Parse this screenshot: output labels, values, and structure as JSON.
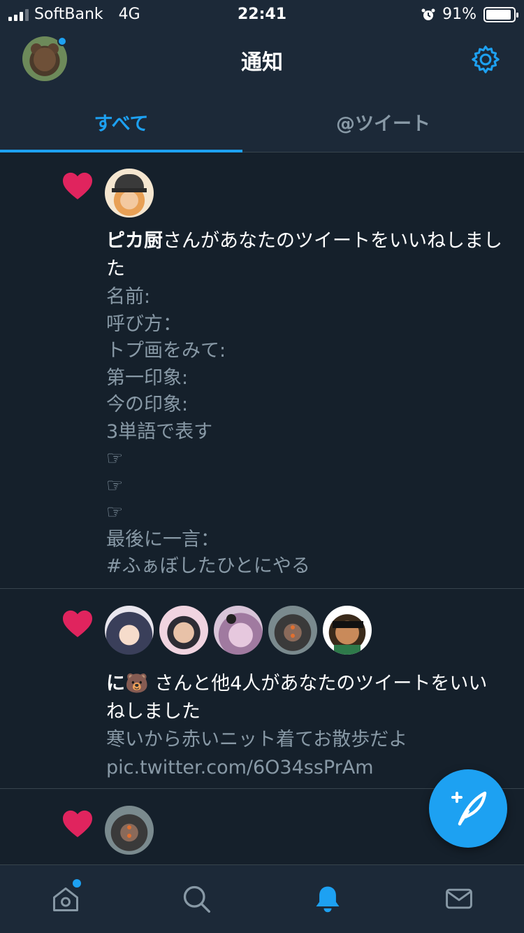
{
  "status_bar": {
    "carrier": "SoftBank",
    "network": "4G",
    "time": "22:41",
    "battery_percent": "91%",
    "battery_level": 0.91
  },
  "header": {
    "title": "通知"
  },
  "tabs": [
    {
      "label": "すべて",
      "selected": true
    },
    {
      "label": "@ツイート",
      "selected": false
    }
  ],
  "notifications": [
    {
      "type": "like",
      "actor_name": "ピカ厨",
      "action_text": "さんがあなたのツイートをいいねしました",
      "tweet_lines": [
        "名前:",
        "呼び方：",
        "トプ画をみて:",
        "第一印象:",
        "今の印象:",
        "3単語で表す",
        "☞",
        "☞",
        "☞",
        "最後に一言：",
        "#ふぁぼしたひとにやる"
      ]
    },
    {
      "type": "like",
      "actor_name": "に🐻",
      "action_text": "さんと他4人があなたのツイートをいいねしました",
      "tweet_lines": [
        "寒いから赤いニット着てお散歩だよ",
        "pic.twitter.com/6O34ssPrAm"
      ]
    },
    {
      "type": "like"
    }
  ],
  "colors": {
    "background": "#15202b",
    "bar_background": "#1c2938",
    "accent": "#1da1f2",
    "like": "#e0245e",
    "secondary_text": "#8899a6"
  },
  "icons": {
    "tabbar": [
      "home-icon",
      "search-icon",
      "notifications-icon",
      "messages-icon"
    ],
    "fab": "compose-tweet-icon"
  }
}
